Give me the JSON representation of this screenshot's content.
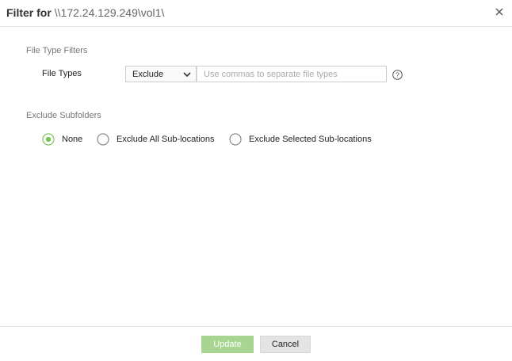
{
  "dialog": {
    "title_prefix": "Filter for",
    "title_path": "\\\\172.24.129.249\\vol1\\",
    "close_icon": "close-icon"
  },
  "file_type_filters": {
    "heading": "File Type Filters",
    "field_label": "File Types",
    "mode_selected": "Exclude",
    "input_value": "",
    "input_placeholder": "Use commas to separate file types",
    "help_icon": "question-circle-icon"
  },
  "exclude_subfolders": {
    "heading": "Exclude Subfolders",
    "options": [
      {
        "label": "None",
        "selected": true
      },
      {
        "label": "Exclude All Sub-locations",
        "selected": false
      },
      {
        "label": "Exclude Selected Sub-locations",
        "selected": false
      }
    ]
  },
  "footer": {
    "update_label": "Update",
    "cancel_label": "Cancel"
  },
  "colors": {
    "accent_green": "#7cc35a",
    "update_button_bg": "#a8d692",
    "radio_border": "#8a8a8a"
  }
}
